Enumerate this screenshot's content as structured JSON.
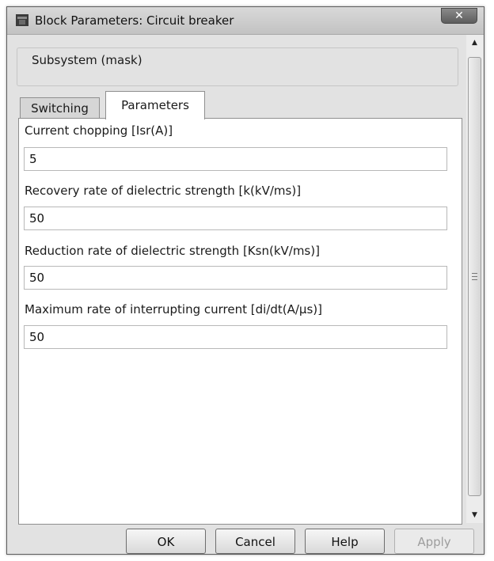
{
  "window": {
    "title": "Block Parameters: Circuit breaker",
    "close_glyph": "✕"
  },
  "group": {
    "label": "Subsystem (mask)"
  },
  "tabs": [
    {
      "label": "Switching",
      "active": false
    },
    {
      "label": "Parameters",
      "active": true
    }
  ],
  "parameters": [
    {
      "label": "Current chopping [Isr(A)]",
      "value": "5"
    },
    {
      "label": "Recovery rate of dielectric strength [k(kV/ms)]",
      "value": "50"
    },
    {
      "label": "Reduction rate of dielectric strength [Ksn(kV/ms)]",
      "value": "50"
    },
    {
      "label": "Maximum rate of interrupting current [di/dt(A/μs)]",
      "value": "50"
    }
  ],
  "buttons": {
    "ok": "OK",
    "cancel": "Cancel",
    "help": "Help",
    "apply": "Apply"
  },
  "scrollbar": {
    "up_glyph": "▲",
    "down_glyph": "▼"
  },
  "icons": {
    "app": "simulink-block-icon",
    "close": "close-icon",
    "scroll_up": "arrow-up-icon",
    "scroll_down": "arrow-down-icon"
  },
  "colors": {
    "window_bg": "#e2e2e2",
    "panel_bg": "#ffffff",
    "titlebar": "#c8c8c8",
    "close_button": "#6e6e6e",
    "disabled_text": "#9d9d9d"
  }
}
